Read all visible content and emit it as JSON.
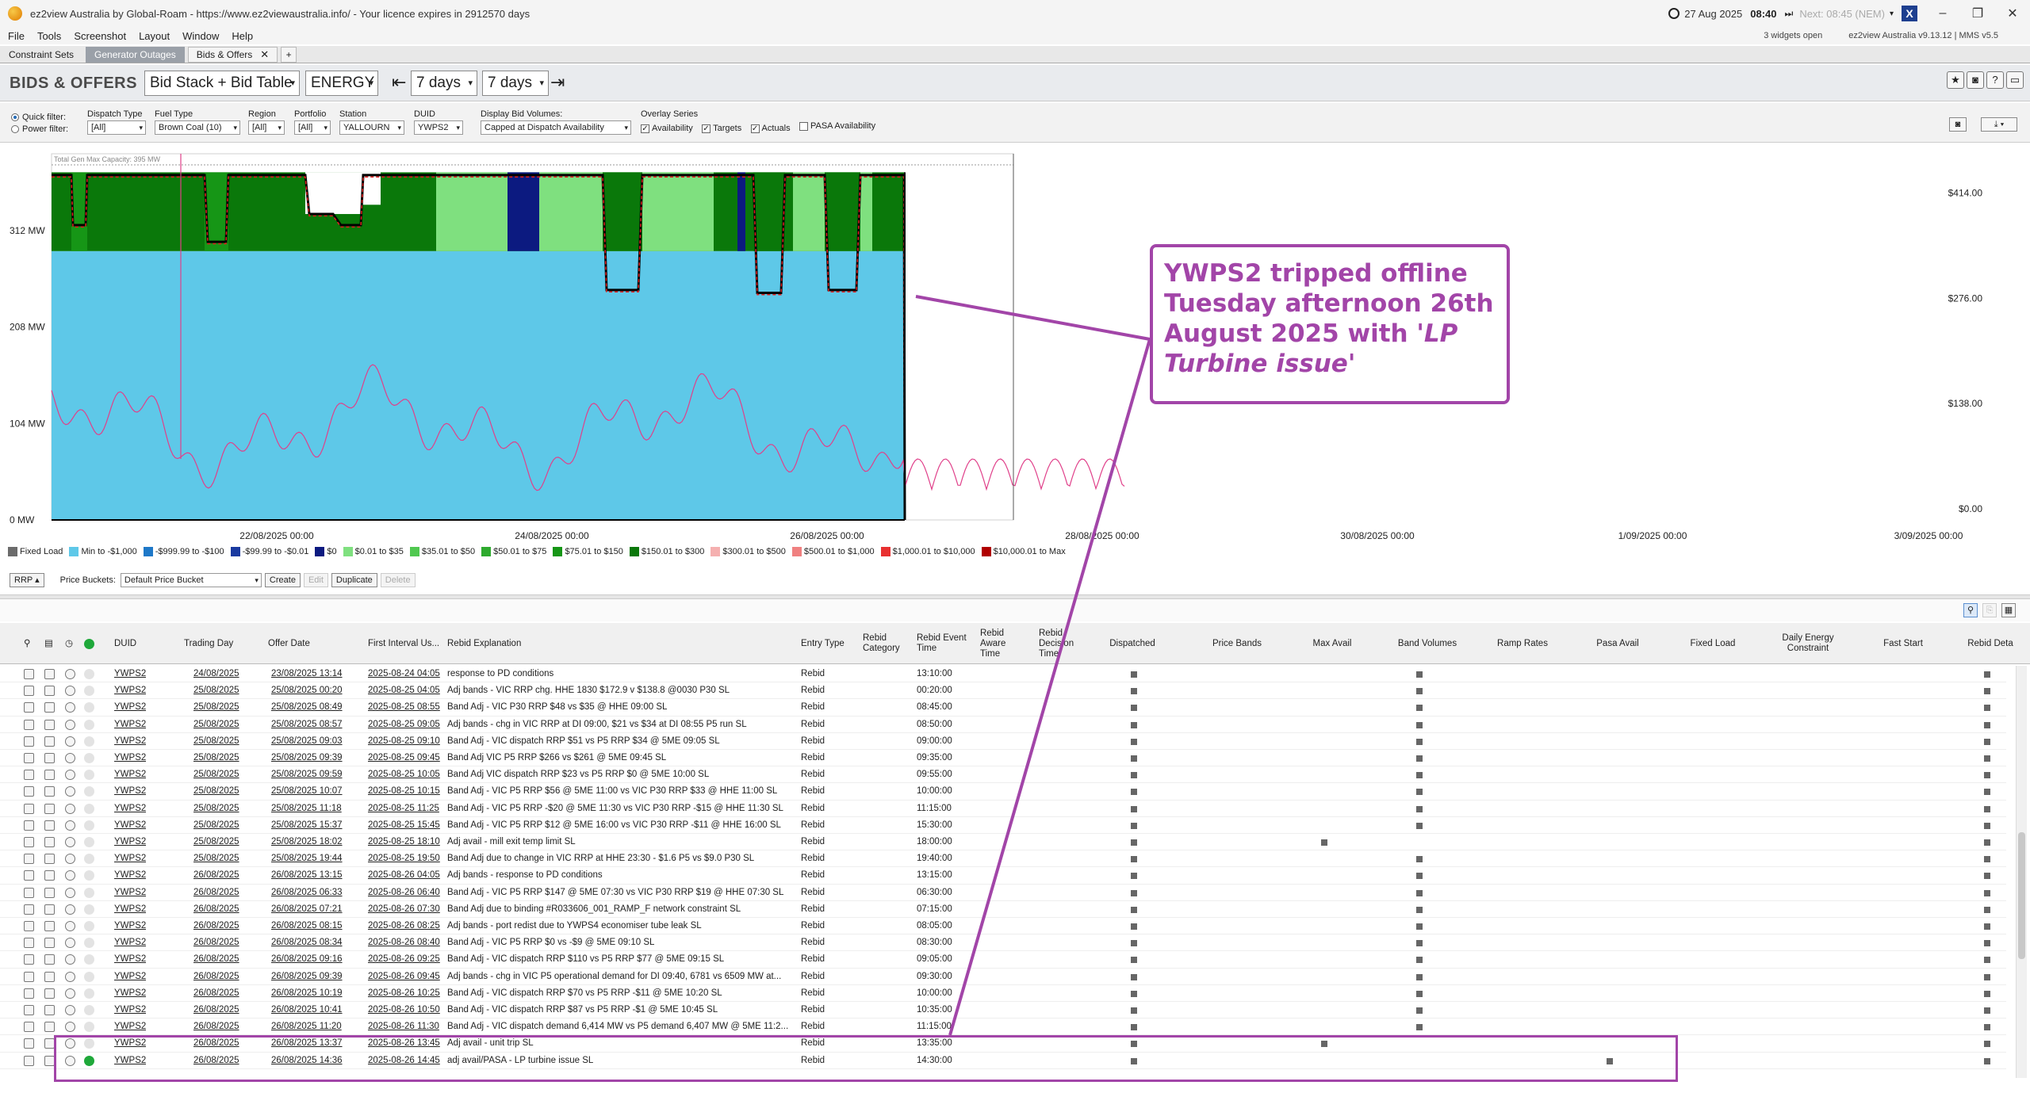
{
  "titlebar": {
    "title": "ez2view Australia by Global-Roam - https://www.ez2viewaustralia.info/ - Your licence expires in 2912570 days",
    "date": "27 Aug 2025",
    "time": "08:40",
    "next": "Next: 08:45 (NEM)"
  },
  "menu": [
    "File",
    "Tools",
    "Screenshot",
    "Layout",
    "Window",
    "Help"
  ],
  "status": {
    "widgets": "3 widgets open",
    "version": "ez2view Australia v9.13.12 | MMS v5.5"
  },
  "tabs": [
    {
      "label": "Constraint Sets"
    },
    {
      "label": "Generator Outages"
    },
    {
      "label": "Bids & Offers"
    }
  ],
  "header": {
    "title": "BIDS & OFFERS",
    "view_mode": "Bid Stack + Bid Table",
    "market": "ENERGY",
    "back_range": "7 days",
    "fwd_range": "7 days"
  },
  "filters": {
    "quick_filter": "Quick filter:",
    "power_filter": "Power filter:",
    "dispatch_type": {
      "label": "Dispatch Type",
      "value": "[All]"
    },
    "fuel_type": {
      "label": "Fuel Type",
      "value": "Brown Coal (10)"
    },
    "region": {
      "label": "Region",
      "value": "[All]"
    },
    "portfolio": {
      "label": "Portfolio",
      "value": "[All]"
    },
    "station": {
      "label": "Station",
      "value": "YALLOURN"
    },
    "duid": {
      "label": "DUID",
      "value": "YWPS2"
    },
    "display_bid_volumes": {
      "label": "Display Bid Volumes:",
      "value": "Capped at Dispatch Availability"
    },
    "overlay": {
      "label": "Overlay Series",
      "availability": "Availability",
      "targets": "Targets",
      "actuals": "Actuals",
      "pasa": "PASA Availability"
    }
  },
  "chart_data": {
    "type": "area",
    "title": "",
    "capacity_label": "Total Gen Max Capacity: 395 MW",
    "y_ticks": [
      "0 MW",
      "104 MW",
      "208 MW",
      "312 MW"
    ],
    "y2_ticks": [
      "$0.00",
      "$138.00",
      "$276.00",
      "$414.00"
    ],
    "x_ticks": [
      "22/08/2025 00:00",
      "24/08/2025 00:00",
      "26/08/2025 00:00",
      "28/08/2025 00:00",
      "30/08/2025 00:00",
      "1/09/2025 00:00",
      "3/09/2025 00:00"
    ],
    "ylim": [
      0,
      395
    ],
    "y2lim": [
      0,
      480
    ]
  },
  "legend": [
    {
      "label": "Fixed Load",
      "color": "#6b6b6b"
    },
    {
      "label": "Min to -$1,000",
      "color": "#5ec8e8"
    },
    {
      "label": "-$999.99 to -$100",
      "color": "#1e78c8"
    },
    {
      "label": "-$99.99 to -$0.01",
      "color": "#1a3aa0"
    },
    {
      "label": "$0",
      "color": "#0c1a80"
    },
    {
      "label": "$0.01 to $35",
      "color": "#7fe07f"
    },
    {
      "label": "$35.01 to $50",
      "color": "#50c850"
    },
    {
      "label": "$50.01 to $75",
      "color": "#2eaa2e"
    },
    {
      "label": "$75.01 to $150",
      "color": "#169616"
    },
    {
      "label": "$150.01 to $300",
      "color": "#0a780a"
    },
    {
      "label": "$300.01 to $500",
      "color": "#f5b0b0"
    },
    {
      "label": "$500.01 to $1,000",
      "color": "#f08080"
    },
    {
      "label": "$1,000.01 to $10,000",
      "color": "#e83030"
    },
    {
      "label": "$10,000.01 to Max",
      "color": "#b00000"
    }
  ],
  "buckets": {
    "rrp": "RRP",
    "label": "Price Buckets:",
    "value": "Default Price Bucket",
    "create": "Create",
    "edit": "Edit",
    "duplicate": "Duplicate",
    "delete": "Delete"
  },
  "table": {
    "headers": [
      "DUID",
      "Trading Day",
      "Offer Date",
      "First Interval Us...",
      "Rebid Explanation",
      "Entry Type",
      "Rebid Category",
      "Rebid Event Time",
      "Rebid Aware Time",
      "Rebid Decision Time",
      "Dispatched",
      "Price Bands",
      "Max Avail",
      "Band Volumes",
      "Ramp Rates",
      "Pasa Avail",
      "Fixed Load",
      "Daily Energy Constraint",
      "Fast Start",
      "Rebid Deta"
    ],
    "rows": [
      {
        "duid": "YWPS2",
        "day": "24/08/2025",
        "offer": "23/08/2025 13:14",
        "first": "2025-08-24 04:05",
        "expl": "response to PD conditions",
        "entry": "Rebid",
        "event": "13:10:00",
        "marks": [
          0,
          3,
          9
        ],
        "dot": "grey"
      },
      {
        "duid": "YWPS2",
        "day": "25/08/2025",
        "offer": "25/08/2025 00:20",
        "first": "2025-08-25 04:05",
        "expl": "Adj bands - VIC RRP chg. HHE 1830 $172.9 v $138.8 @0030 P30 SL",
        "entry": "Rebid",
        "event": "00:20:00",
        "marks": [
          0,
          3,
          9
        ],
        "dot": "grey"
      },
      {
        "duid": "YWPS2",
        "day": "25/08/2025",
        "offer": "25/08/2025 08:49",
        "first": "2025-08-25 08:55",
        "expl": "Band Adj - VIC P30 RRP $48 vs $35 @ HHE 09:00 SL",
        "entry": "Rebid",
        "event": "08:45:00",
        "marks": [
          0,
          3,
          9
        ],
        "dot": "grey"
      },
      {
        "duid": "YWPS2",
        "day": "25/08/2025",
        "offer": "25/08/2025 08:57",
        "first": "2025-08-25 09:05",
        "expl": "Adj bands - chg in VIC RRP at DI 09:00, $21 vs $34 at DI 08:55 P5 run SL",
        "entry": "Rebid",
        "event": "08:50:00",
        "marks": [
          0,
          3,
          9
        ],
        "dot": "grey"
      },
      {
        "duid": "YWPS2",
        "day": "25/08/2025",
        "offer": "25/08/2025 09:03",
        "first": "2025-08-25 09:10",
        "expl": "Band Adj - VIC dispatch RRP $51 vs P5 RRP $34 @ 5ME 09:05 SL",
        "entry": "Rebid",
        "event": "09:00:00",
        "marks": [
          0,
          3,
          9
        ],
        "dot": "grey"
      },
      {
        "duid": "YWPS2",
        "day": "25/08/2025",
        "offer": "25/08/2025 09:39",
        "first": "2025-08-25 09:45",
        "expl": "Band Adj VIC P5 RRP $266 vs $261 @ 5ME 09:45 SL",
        "entry": "Rebid",
        "event": "09:35:00",
        "marks": [
          0,
          3,
          9
        ],
        "dot": "grey"
      },
      {
        "duid": "YWPS2",
        "day": "25/08/2025",
        "offer": "25/08/2025 09:59",
        "first": "2025-08-25 10:05",
        "expl": "Band Adj VIC dispatch RRP $23 vs P5 RRP $0 @ 5ME 10:00 SL",
        "entry": "Rebid",
        "event": "09:55:00",
        "marks": [
          0,
          3,
          9
        ],
        "dot": "grey"
      },
      {
        "duid": "YWPS2",
        "day": "25/08/2025",
        "offer": "25/08/2025 10:07",
        "first": "2025-08-25 10:15",
        "expl": "Band Adj - VIC P5 RRP $56 @ 5ME 11:00 vs VIC P30 RRP $33 @ HHE 11:00 SL",
        "entry": "Rebid",
        "event": "10:00:00",
        "marks": [
          0,
          3,
          9
        ],
        "dot": "grey"
      },
      {
        "duid": "YWPS2",
        "day": "25/08/2025",
        "offer": "25/08/2025 11:18",
        "first": "2025-08-25 11:25",
        "expl": "Band Adj - VIC P5 RRP -$20 @ 5ME 11:30 vs VIC P30 RRP -$15 @ HHE 11:30 SL",
        "entry": "Rebid",
        "event": "11:15:00",
        "marks": [
          0,
          3,
          9
        ],
        "dot": "grey"
      },
      {
        "duid": "YWPS2",
        "day": "25/08/2025",
        "offer": "25/08/2025 15:37",
        "first": "2025-08-25 15:45",
        "expl": "Band Adj - VIC P5 RRP $12 @ 5ME 16:00 vs VIC P30 RRP -$11 @ HHE 16:00 SL",
        "entry": "Rebid",
        "event": "15:30:00",
        "marks": [
          0,
          3,
          9
        ],
        "dot": "grey"
      },
      {
        "duid": "YWPS2",
        "day": "25/08/2025",
        "offer": "25/08/2025 18:02",
        "first": "2025-08-25 18:10",
        "expl": "Adj avail - mill exit temp limit SL",
        "entry": "Rebid",
        "event": "18:00:00",
        "marks": [
          0,
          2,
          9
        ],
        "dot": "grey"
      },
      {
        "duid": "YWPS2",
        "day": "25/08/2025",
        "offer": "25/08/2025 19:44",
        "first": "2025-08-25 19:50",
        "expl": "Band Adj due to change in VIC RRP at HHE 23:30 - $1.6 P5 vs $9.0 P30 SL",
        "entry": "Rebid",
        "event": "19:40:00",
        "marks": [
          0,
          3,
          9
        ],
        "dot": "grey"
      },
      {
        "duid": "YWPS2",
        "day": "26/08/2025",
        "offer": "26/08/2025 13:15",
        "first": "2025-08-26 04:05",
        "expl": "Adj bands - response to PD conditions",
        "entry": "Rebid",
        "event": "13:15:00",
        "marks": [
          0,
          3,
          9
        ],
        "dot": "grey"
      },
      {
        "duid": "YWPS2",
        "day": "26/08/2025",
        "offer": "26/08/2025 06:33",
        "first": "2025-08-26 06:40",
        "expl": "Band Adj - VIC P5 RRP $147 @ 5ME 07:30 vs VIC P30 RRP $19 @ HHE 07:30 SL",
        "entry": "Rebid",
        "event": "06:30:00",
        "marks": [
          0,
          3,
          9
        ],
        "dot": "grey"
      },
      {
        "duid": "YWPS2",
        "day": "26/08/2025",
        "offer": "26/08/2025 07:21",
        "first": "2025-08-26 07:30",
        "expl": "Band Adj due to binding #R033606_001_RAMP_F network constraint SL",
        "entry": "Rebid",
        "event": "07:15:00",
        "marks": [
          0,
          3,
          9
        ],
        "dot": "grey"
      },
      {
        "duid": "YWPS2",
        "day": "26/08/2025",
        "offer": "26/08/2025 08:15",
        "first": "2025-08-26 08:25",
        "expl": "Adj bands - port redist due to YWPS4 economiser tube leak SL",
        "entry": "Rebid",
        "event": "08:05:00",
        "marks": [
          0,
          3,
          9
        ],
        "dot": "grey"
      },
      {
        "duid": "YWPS2",
        "day": "26/08/2025",
        "offer": "26/08/2025 08:34",
        "first": "2025-08-26 08:40",
        "expl": "Band Adj - VIC P5 RRP $0 vs -$9 @ 5ME 09:10 SL",
        "entry": "Rebid",
        "event": "08:30:00",
        "marks": [
          0,
          3,
          9
        ],
        "dot": "grey"
      },
      {
        "duid": "YWPS2",
        "day": "26/08/2025",
        "offer": "26/08/2025 09:16",
        "first": "2025-08-26 09:25",
        "expl": "Band Adj - VIC dispatch RRP $110 vs P5 RRP $77 @ 5ME 09:15 SL",
        "entry": "Rebid",
        "event": "09:05:00",
        "marks": [
          0,
          3,
          9
        ],
        "dot": "grey"
      },
      {
        "duid": "YWPS2",
        "day": "26/08/2025",
        "offer": "26/08/2025 09:39",
        "first": "2025-08-26 09:45",
        "expl": "Adj bands - chg in VIC P5 operational demand for DI 09:40, 6781 vs 6509 MW at...",
        "entry": "Rebid",
        "event": "09:30:00",
        "marks": [
          0,
          3,
          9
        ],
        "dot": "grey"
      },
      {
        "duid": "YWPS2",
        "day": "26/08/2025",
        "offer": "26/08/2025 10:19",
        "first": "2025-08-26 10:25",
        "expl": "Band Adj - VIC dispatch RRP $70 vs P5 RRP -$11 @ 5ME 10:20 SL",
        "entry": "Rebid",
        "event": "10:00:00",
        "marks": [
          0,
          3,
          9
        ],
        "dot": "grey"
      },
      {
        "duid": "YWPS2",
        "day": "26/08/2025",
        "offer": "26/08/2025 10:41",
        "first": "2025-08-26 10:50",
        "expl": "Band Adj - VIC dispatch RRP $87 vs P5 RRP -$1 @ 5ME 10:45 SL",
        "entry": "Rebid",
        "event": "10:35:00",
        "marks": [
          0,
          3,
          9
        ],
        "dot": "grey"
      },
      {
        "duid": "YWPS2",
        "day": "26/08/2025",
        "offer": "26/08/2025 11:20",
        "first": "2025-08-26 11:30",
        "expl": "Band Adj - VIC dispatch demand 6,414 MW vs P5 demand 6,407 MW @ 5ME 11:2...",
        "entry": "Rebid",
        "event": "11:15:00",
        "marks": [
          0,
          3,
          9
        ],
        "dot": "grey"
      },
      {
        "duid": "YWPS2",
        "day": "26/08/2025",
        "offer": "26/08/2025 13:37",
        "first": "2025-08-26 13:45",
        "expl": "Adj avail - unit trip SL",
        "entry": "Rebid",
        "event": "13:35:00",
        "marks": [
          0,
          2,
          9
        ],
        "dot": "grey"
      },
      {
        "duid": "YWPS2",
        "day": "26/08/2025",
        "offer": "26/08/2025 14:36",
        "first": "2025-08-26 14:45",
        "expl": "adj avail/PASA - LP turbine issue SL",
        "entry": "Rebid",
        "event": "14:30:00",
        "marks": [
          0,
          5,
          9
        ],
        "dot": "green"
      }
    ]
  },
  "annotation": {
    "line1": "YWPS2 tripped offline",
    "line2": "Tuesday afternoon 26th",
    "line3": "August 2025 with",
    "quote1": "'LP",
    "quote2": "Turbine issue'"
  }
}
